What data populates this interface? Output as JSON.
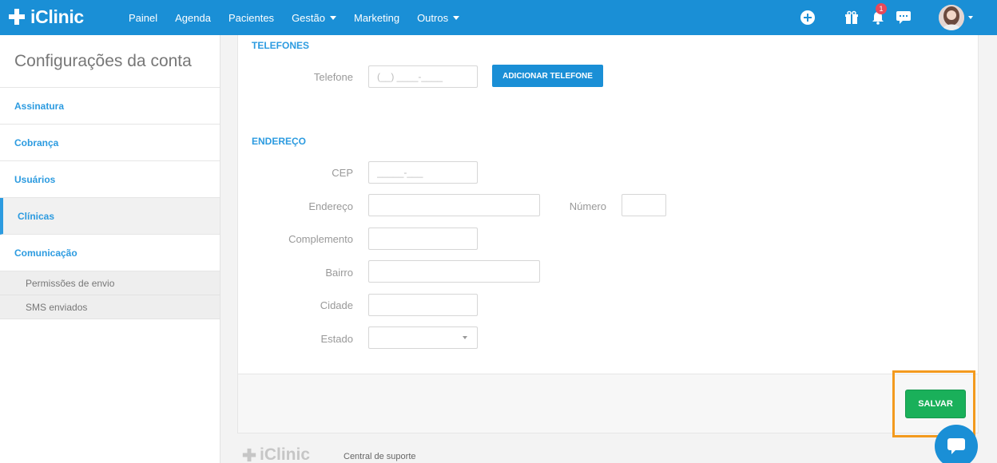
{
  "brand": {
    "name": "iClinic"
  },
  "nav": [
    {
      "label": "Painel"
    },
    {
      "label": "Agenda"
    },
    {
      "label": "Pacientes"
    },
    {
      "label": "Gestão"
    },
    {
      "label": "Marketing"
    },
    {
      "label": "Outros"
    }
  ],
  "header_icons": [
    "plus-circle-icon",
    "gift-icon",
    "bell-icon",
    "chat-icon"
  ],
  "notifications": {
    "count": "1"
  },
  "sidebar": {
    "title": "Configurações da conta",
    "items": [
      {
        "label": "Assinatura"
      },
      {
        "label": "Cobrança"
      },
      {
        "label": "Usuários"
      },
      {
        "label": "Clínicas"
      },
      {
        "label": "Comunicação"
      }
    ],
    "subitems": [
      {
        "label": "Permissões de envio"
      },
      {
        "label": "SMS enviados"
      }
    ]
  },
  "phones": {
    "title": "TELEFONES",
    "label": "Telefone",
    "placeholder": "(__) ____-____",
    "add_button": "ADICIONAR TELEFONE"
  },
  "address": {
    "title": "ENDEREÇO",
    "cep_label": "CEP",
    "cep_placeholder": "_____-___",
    "endereco_label": "Endereço",
    "numero_label": "Número",
    "complemento_label": "Complemento",
    "bairro_label": "Bairro",
    "cidade_label": "Cidade",
    "estado_label": "Estado"
  },
  "actions": {
    "save": "SALVAR"
  },
  "footer": {
    "logo": "iClinic",
    "support": "Central de suporte"
  },
  "colors": {
    "primary": "#1a8fd6",
    "save": "#1ab05a",
    "highlight": "#f39a1e"
  }
}
